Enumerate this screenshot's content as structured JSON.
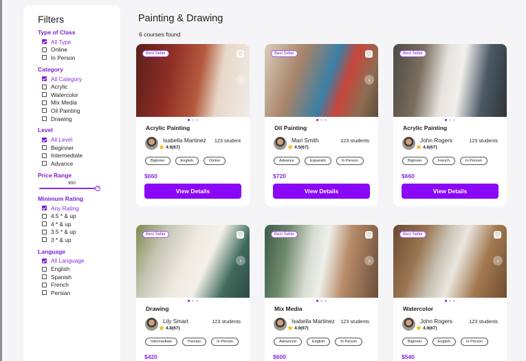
{
  "filters": {
    "title": "Filters",
    "groups": {
      "type": {
        "title": "Type of Class",
        "options": [
          "All Type",
          "Online",
          "In Person"
        ]
      },
      "category": {
        "title": "Category",
        "options": [
          "All Category",
          "Acrylic",
          "Watercolor",
          "Mix Media",
          "Oil Painting",
          "Drawing"
        ]
      },
      "level": {
        "title": "Level",
        "options": [
          "All Level",
          "Beginner",
          "Intermediate",
          "Advance"
        ]
      },
      "rating": {
        "title": "Minimum Rating",
        "options": [
          "Any Rating",
          "4.5 *  & up",
          "4 * & up",
          "3.5 * & up",
          "3 * & up"
        ]
      },
      "language": {
        "title": "Language",
        "options": [
          "All Language",
          "English",
          "Spanish",
          "French",
          "Persian"
        ]
      }
    },
    "price": {
      "title": "Price Range",
      "value": "900",
      "slider_level": 1.0
    }
  },
  "page": {
    "title": "Painting & Drawing",
    "count": "6 courses found"
  },
  "common": {
    "badge": "Best Seller",
    "button": "View Details",
    "heart": "♡",
    "star": "★",
    "arrow": "›"
  },
  "courses": [
    {
      "title": "Acrylic Painting",
      "instructor": "Isabella Martinez",
      "rating": "4.9(67)",
      "students": "123 student",
      "tags": [
        "Biginner",
        "English",
        "Online"
      ],
      "price": "$660",
      "active_dot": 0,
      "heart_visible": true,
      "arrow_visible": true
    },
    {
      "title": "Oil Painting",
      "instructor": "Mari Smith",
      "rating": "4.5(67)",
      "students": "123 students",
      "tags": [
        "Advance",
        "Espanish",
        "In Person"
      ],
      "price": "$720",
      "active_dot": 0,
      "heart_visible": true,
      "arrow_visible": true
    },
    {
      "title": "Acrylic Painting",
      "instructor": "John Rogers",
      "rating": "4.6(67)",
      "students": "123 students",
      "tags": [
        "Biginner",
        "French",
        "In Person"
      ],
      "price": "$660",
      "active_dot": 0,
      "heart_visible": false,
      "arrow_visible": false
    },
    {
      "title": "Drawing",
      "instructor": "Lily Smart",
      "rating": "4.8(67)",
      "students": "123 students",
      "tags": [
        "Intermediate",
        "Persian",
        "In Person"
      ],
      "price": "$420",
      "active_dot": 0,
      "heart_visible": true,
      "arrow_visible": true
    },
    {
      "title": "Mix Media",
      "instructor": "Isabella Martinez",
      "rating": "4.9(67)",
      "students": "123 students",
      "tags": [
        "Advanced",
        "English",
        "In Person"
      ],
      "price": "$600",
      "active_dot": 0,
      "heart_visible": true,
      "arrow_visible": true
    },
    {
      "title": "Watercolor",
      "instructor": "John Rogers",
      "rating": "4.9(67)",
      "students": "123 students",
      "tags": [
        "Biginner",
        "English",
        "In Person"
      ],
      "price": "$540",
      "active_dot": 0,
      "heart_visible": true,
      "arrow_visible": true
    }
  ],
  "colors": {
    "accent": "#8a07f6",
    "accent_text": "#7c1ed0",
    "star": "#f4b400"
  }
}
